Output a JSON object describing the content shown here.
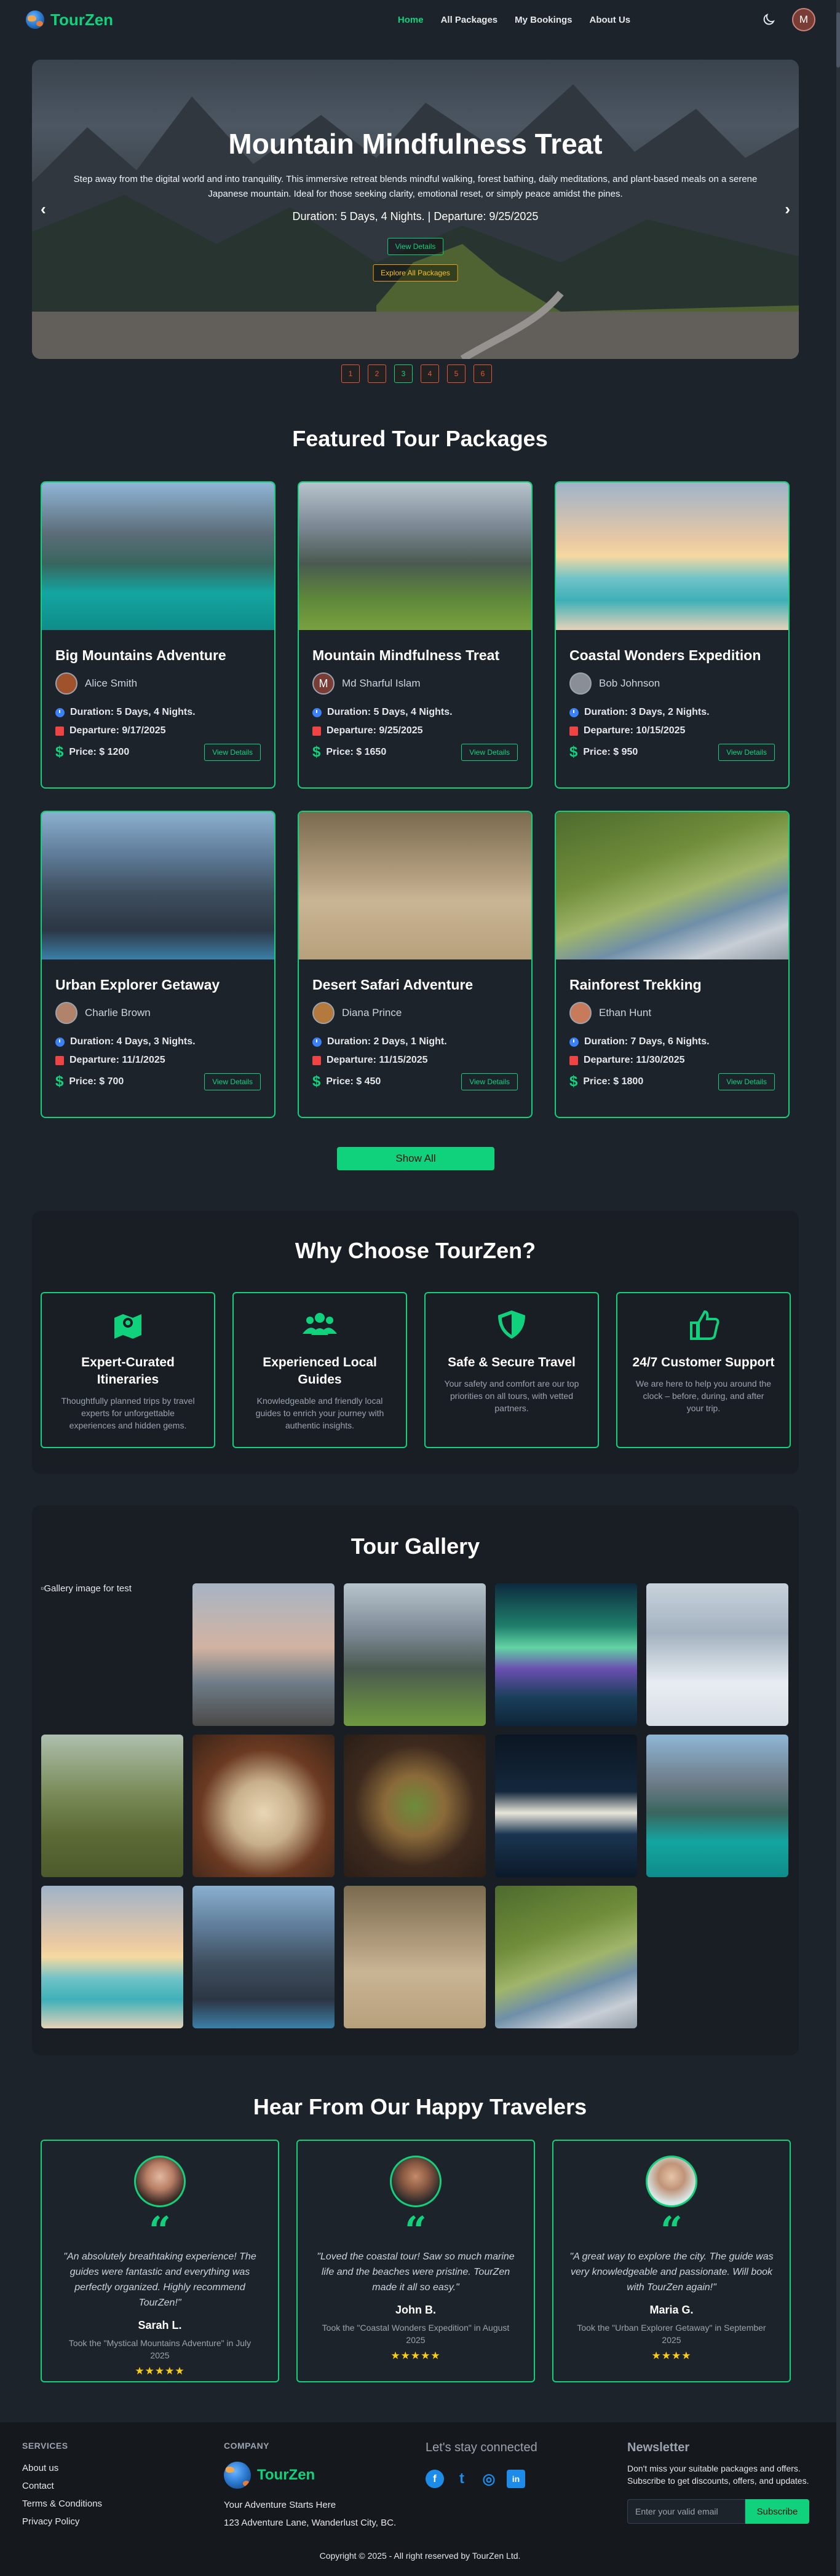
{
  "nav": {
    "brand": "TourZen",
    "links": [
      "Home",
      "All Packages",
      "My Bookings",
      "About Us"
    ],
    "avatar_initial": "M"
  },
  "hero": {
    "title": "Mountain Mindfulness Treat",
    "description": "Step away from the digital world and into tranquility. This immersive retreat blends mindful walking, forest bathing, daily meditations, and plant-based meals on a serene Japanese mountain. Ideal for those seeking clarity, emotional reset, or simply peace amidst the pines.",
    "meta": "Duration: 5 Days, 4 Nights. | Departure: 9/25/2025",
    "view_details": "View Details",
    "explore_all": "Explore All Packages",
    "prev": "‹",
    "next": "›",
    "pages": [
      "1",
      "2",
      "3",
      "4",
      "5",
      "6"
    ]
  },
  "featured": {
    "title": "Featured Tour Packages",
    "cards": [
      {
        "title": "Big Mountains Adventure",
        "guide": "Alice Smith",
        "duration": "Duration: 5 Days, 4 Nights.",
        "departure": "Departure: 9/17/2025",
        "price": "Price: $ 1200",
        "button": "View Details"
      },
      {
        "title": "Mountain Mindfulness Treat",
        "guide": "Md Sharful Islam",
        "guide_initial": "M",
        "duration": "Duration: 5 Days, 4 Nights.",
        "departure": "Departure: 9/25/2025",
        "price": "Price: $ 1650",
        "button": "View Details"
      },
      {
        "title": "Coastal Wonders Expedition",
        "guide": "Bob Johnson",
        "duration": "Duration: 3 Days, 2 Nights.",
        "departure": "Departure: 10/15/2025",
        "price": "Price: $ 950",
        "button": "View Details"
      },
      {
        "title": "Urban Explorer Getaway",
        "guide": "Charlie Brown",
        "duration": "Duration: 4 Days, 3 Nights.",
        "departure": "Departure: 11/1/2025",
        "price": "Price: $ 700",
        "button": "View Details"
      },
      {
        "title": "Desert Safari Adventure",
        "guide": "Diana Prince",
        "duration": "Duration: 2 Days, 1 Night.",
        "departure": "Departure: 11/15/2025",
        "price": "Price: $ 450",
        "button": "View Details"
      },
      {
        "title": "Rainforest Trekking",
        "guide": "Ethan Hunt",
        "duration": "Duration: 7 Days, 6 Nights.",
        "departure": "Departure: 11/30/2025",
        "price": "Price: $ 1800",
        "button": "View Details"
      }
    ],
    "show_all": "Show All"
  },
  "why": {
    "title": "Why Choose TourZen?",
    "features": [
      {
        "icon": "map-icon",
        "title": "Expert-Curated Itineraries",
        "text": "Thoughtfully planned trips by travel experts for unforgettable experiences and hidden gems."
      },
      {
        "icon": "users-icon",
        "title": "Experienced Local Guides",
        "text": "Knowledgeable and friendly local guides to enrich your journey with authentic insights."
      },
      {
        "icon": "shield-icon",
        "title": "Safe & Secure Travel",
        "text": "Your safety and comfort are our top priorities on all tours, with vetted partners."
      },
      {
        "icon": "thumbs-up-icon",
        "title": "24/7 Customer Support",
        "text": "We are here to help you around the clock – before, during, and after your trip."
      }
    ]
  },
  "gallery": {
    "title": "Tour Gallery",
    "broken_alt": "Gallery image for test"
  },
  "testimonials": {
    "title": "Hear From Our Happy Travelers",
    "items": [
      {
        "quote": "\"An absolutely breathtaking experience! The guides were fantastic and everything was perfectly organized. Highly recommend TourZen!\"",
        "name": "Sarah L.",
        "trip": "Took the \"Mystical Mountains Adventure\" in July 2025",
        "stars": "★★★★★"
      },
      {
        "quote": "\"Loved the coastal tour! Saw so much marine life and the beaches were pristine. TourZen made it all so easy.\"",
        "name": "John B.",
        "trip": "Took the \"Coastal Wonders Expedition\" in August 2025",
        "stars": "★★★★★"
      },
      {
        "quote": "\"A great way to explore the city. The guide was very knowledgeable and passionate. Will book with TourZen again!\"",
        "name": "Maria G.",
        "trip": "Took the \"Urban Explorer Getaway\" in September 2025",
        "stars": "★★★★"
      }
    ]
  },
  "footer": {
    "services_heading": "SERVICES",
    "services": [
      "About us",
      "Contact",
      "Terms & Conditions",
      "Privacy Policy"
    ],
    "company_heading": "COMPANY",
    "brand": "TourZen",
    "tagline": "Your Adventure Starts Here",
    "address": "123 Adventure Lane, Wanderlust City, BC.",
    "social_heading": "Let's stay connected",
    "social": [
      "f",
      "t",
      "◎",
      "in"
    ],
    "newsletter_heading": "Newsletter",
    "newsletter_text": "Don't miss your suitable packages and offers. Subscribe to get discounts, offers, and updates.",
    "email_placeholder": "Enter your valid email",
    "subscribe": "Subscribe",
    "copyright": "Copyright © 2025 - All right reserved by TourZen Ltd."
  }
}
